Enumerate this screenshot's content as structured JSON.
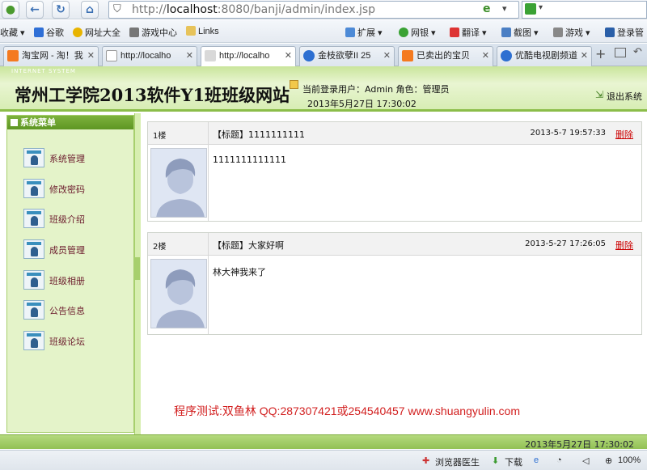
{
  "browser": {
    "url_prefix": "http://",
    "url_host": "localhost",
    "url_rest": ":8080/banji/admin/index.jsp",
    "bookmarks": [
      {
        "label": "收藏",
        "icon": "star-icon"
      },
      {
        "label": "谷歌",
        "icon": "google-icon"
      },
      {
        "label": "网址大全",
        "icon": "sites-icon"
      },
      {
        "label": "游戏中心",
        "icon": "gamepad-icon"
      },
      {
        "label": "Links",
        "icon": "folder-icon"
      }
    ],
    "toolbar_right": [
      {
        "label": "扩展",
        "icon": "extensions-icon"
      },
      {
        "label": "网银",
        "icon": "bank-icon"
      },
      {
        "label": "翻译",
        "icon": "translate-icon"
      },
      {
        "label": "截图",
        "icon": "screenshot-icon"
      },
      {
        "label": "游戏",
        "icon": "game-icon"
      },
      {
        "label": "登录管",
        "icon": "login-icon"
      }
    ],
    "tabs": [
      {
        "label": "淘宝网 - 淘！我",
        "icon": "taobao-icon",
        "active": false
      },
      {
        "label": "http://localho",
        "icon": "page-icon",
        "active": false
      },
      {
        "label": "http://localho",
        "icon": "pma-icon",
        "active": true
      },
      {
        "label": "金枝欲孽II 25",
        "icon": "video-icon",
        "active": false
      },
      {
        "label": "已卖出的宝贝",
        "icon": "taobao-icon",
        "active": false
      },
      {
        "label": "优酷电视剧频道",
        "icon": "video-icon",
        "active": false
      }
    ],
    "status": {
      "doctor": "浏览器医生",
      "download": "下载",
      "zoom": "100%"
    }
  },
  "header": {
    "subtitle": "INTERNET SYSTEM",
    "title": "常州工学院2013软件Y1班班级网站",
    "user_info": "当前登录用户：Admin 角色：管理员",
    "date": "2013年5月27日  17:30:02",
    "logout": "退出系统"
  },
  "sidebar": {
    "heading": "系统菜单",
    "items": [
      {
        "label": "系统管理"
      },
      {
        "label": "修改密码"
      },
      {
        "label": "班级介绍"
      },
      {
        "label": "成员管理"
      },
      {
        "label": "班级相册"
      },
      {
        "label": "公告信息"
      },
      {
        "label": "班级论坛"
      }
    ]
  },
  "posts": [
    {
      "floor": "1楼",
      "title": "【标题】1111111111",
      "date": "2013-5-7 19:57:33",
      "delete": "删除",
      "body": "1111111111111"
    },
    {
      "floor": "2楼",
      "title": "【标题】大家好啊",
      "date": "2013-5-27 17:26:05",
      "delete": "删除",
      "body": "林大神我来了"
    }
  ],
  "credit": "程序测试:双鱼林 QQ:287307421或254540457 www.shuangyulin.com",
  "footer": {
    "date": "2013年5月27日  17:30:02"
  },
  "colors": {
    "header_green": "#c9e59b",
    "menu_text": "#6b1a2c",
    "delete_red": "#cc0000",
    "credit_red": "#d21f1f"
  }
}
